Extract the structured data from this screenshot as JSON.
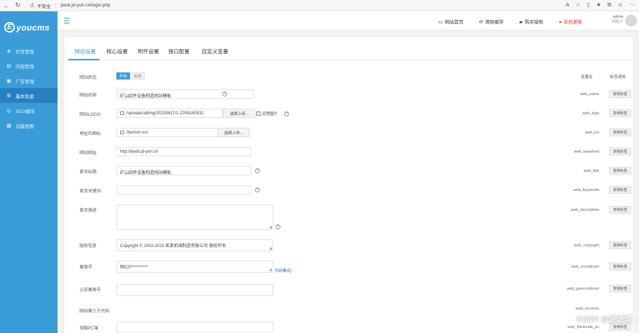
{
  "browser": {
    "security": "不安全",
    "url": "jiaob.jd-yun.cn/login.php"
  },
  "sidebar": {
    "logo_text": "youcms",
    "logo_letter": "E",
    "items": [
      {
        "label": "栏目管理",
        "icon": "layers-icon"
      },
      {
        "label": "内容管理",
        "icon": "document-icon"
      },
      {
        "label": "广告管理",
        "icon": "ad-icon"
      },
      {
        "label": "基本信息",
        "icon": "gear-icon"
      },
      {
        "label": "SEO模块",
        "icon": "seo-icon"
      },
      {
        "label": "功能地图",
        "icon": "grid-icon"
      }
    ]
  },
  "topbar": {
    "links": [
      {
        "label": "网站首页",
        "icon": "monitor-icon"
      },
      {
        "label": "清除缓存",
        "icon": "refresh-icon"
      },
      {
        "label": "购买授权",
        "icon": "bookmark-icon"
      },
      {
        "label": "系统更新",
        "icon": "update-icon",
        "color": "#e23a2a"
      }
    ],
    "user_name": "admin",
    "user_role": "创始人"
  },
  "tabs": [
    "网站设置",
    "核心设置",
    "附件设置",
    "接口配置",
    "自定义变量"
  ],
  "columns": {
    "var": "变量名",
    "tag": "标签调用"
  },
  "copy_tag_label": "复制标签",
  "toggle": {
    "on": "开启",
    "off": "关闭"
  },
  "upload_label": "选择上传...",
  "remote_image_label": "远程图片",
  "code_mode_label": "代码模式]",
  "fields": [
    {
      "label": "网站状态",
      "value": "",
      "var": "web_status"
    },
    {
      "label": "网站名称",
      "value": "矿山四件设备制造网站模板",
      "var": "web_name"
    },
    {
      "label": "网站LOGO",
      "value": "/uploads/allimg/20220617/1-2206160531",
      "var": "web_logo"
    },
    {
      "label": "地址栏图标",
      "value": "/favicon.ico",
      "var": "web_ico"
    },
    {
      "label": "网站网址",
      "value": "http://jiaob.jd-yun.cn",
      "var": "web_basehost"
    },
    {
      "label": "首页标题",
      "value": "矿山四件设备制造网站模板",
      "var": "web_title"
    },
    {
      "label": "首页关键词",
      "value": "",
      "var": "web_keywords"
    },
    {
      "label": "首页描述",
      "value": "",
      "var": "web_description"
    },
    {
      "label": "版权信息",
      "value": "Copyright © 2002-2023 某某机械制造有限公司 版权所有",
      "var": "web_copyright"
    },
    {
      "label": "备案号",
      "value": "网ICP**********",
      "var": "web_recordnum"
    },
    {
      "label": "公安备案号",
      "value": "",
      "var": "web_garecordnum"
    },
    {
      "label": "网站第三方代码",
      "value": "",
      "var": "web_recorum"
    },
    {
      "label": "电脑PC端",
      "value": "",
      "var": "web_thirdcode_pc"
    }
  ],
  "watermark": "CSDN @途途理"
}
